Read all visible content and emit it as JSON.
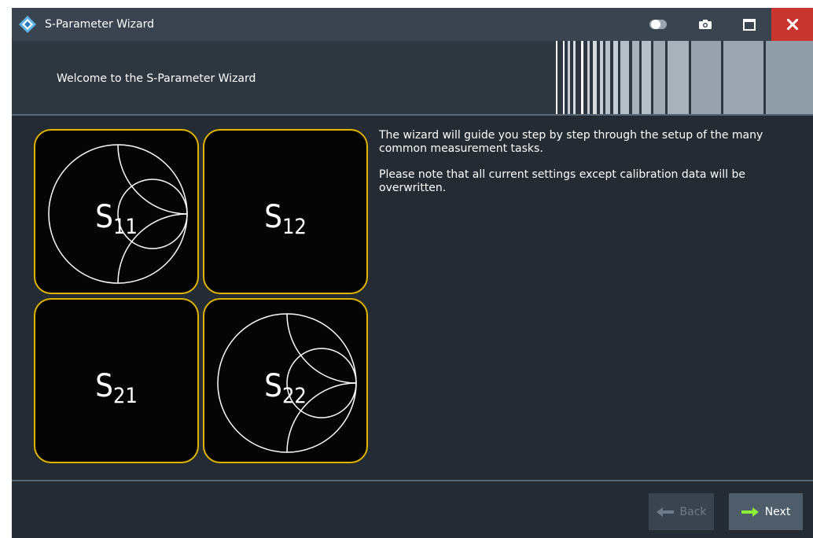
{
  "window": {
    "title": "S-Parameter Wizard",
    "app_icon": "rohde-schwarz-logo-icon",
    "controls": {
      "toggle_icon": "toggle-icon",
      "camera_icon": "camera-icon",
      "maximize_icon": "maximize-icon",
      "close_icon": "close-icon"
    }
  },
  "header": {
    "welcome": "Welcome to the S-Parameter Wizard"
  },
  "tiles": [
    {
      "main": "S",
      "sub": "11",
      "icon": "smith-chart-icon"
    },
    {
      "main": "S",
      "sub": "12",
      "icon": ""
    },
    {
      "main": "S",
      "sub": "21",
      "icon": ""
    },
    {
      "main": "S",
      "sub": "22",
      "icon": "smith-chart-icon"
    }
  ],
  "description": {
    "paragraph1": "The wizard will guide you step by step through the setup of the many common measurement tasks.",
    "paragraph2": "Please note that all current settings except calibration data will be overwritten."
  },
  "buttons": {
    "back": {
      "label": "Back",
      "icon": "arrow-left-icon",
      "enabled": false
    },
    "next": {
      "label": "Next",
      "icon": "arrow-right-icon",
      "enabled": true
    }
  },
  "colors": {
    "titlebar": "#3a4350",
    "background": "#252b33",
    "tile_border": "#e0b400",
    "close_button": "#c8362f",
    "next_arrow": "#8cf03a"
  }
}
